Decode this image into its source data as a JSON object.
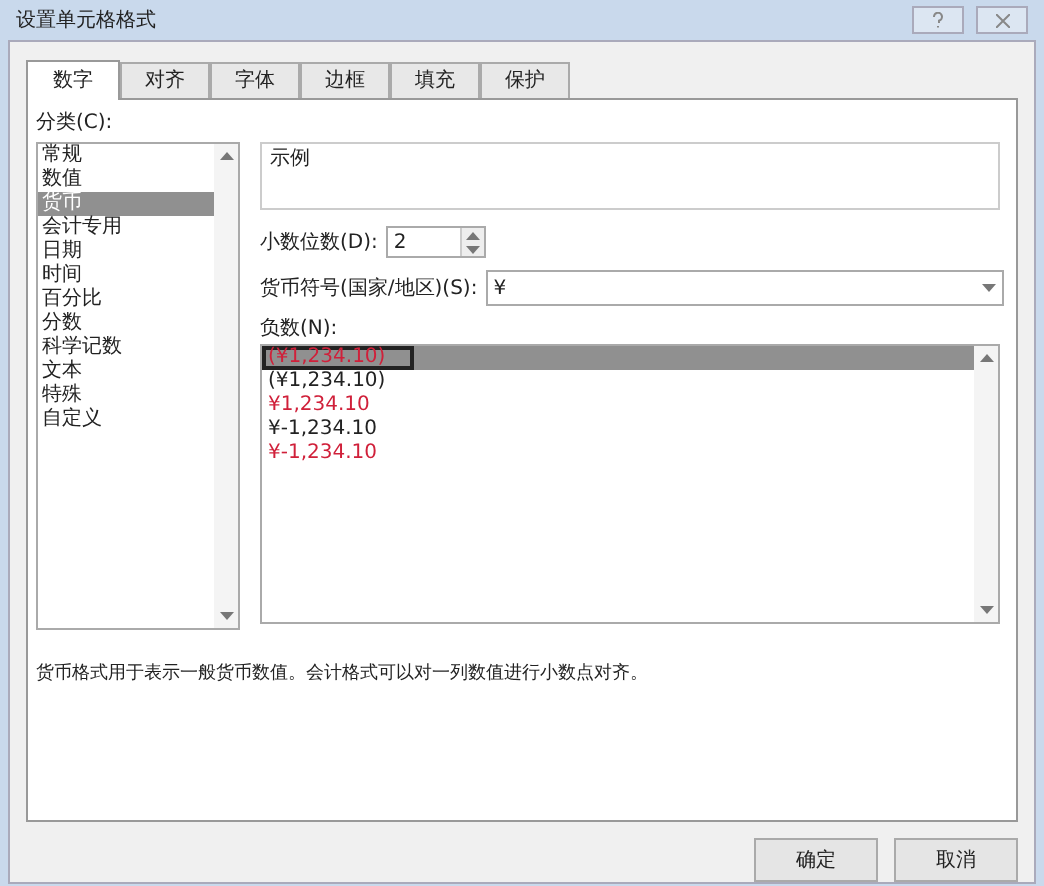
{
  "window": {
    "title": "设置单元格格式"
  },
  "tabs": [
    {
      "label": "数字",
      "selected": true
    },
    {
      "label": "对齐",
      "selected": false
    },
    {
      "label": "字体",
      "selected": false
    },
    {
      "label": "边框",
      "selected": false
    },
    {
      "label": "填充",
      "selected": false
    },
    {
      "label": "保护",
      "selected": false
    }
  ],
  "category": {
    "label": "分类(C):",
    "items": [
      {
        "label": "常规",
        "selected": false
      },
      {
        "label": "数值",
        "selected": false
      },
      {
        "label": "货币",
        "selected": true
      },
      {
        "label": "会计专用",
        "selected": false
      },
      {
        "label": "日期",
        "selected": false
      },
      {
        "label": "时间",
        "selected": false
      },
      {
        "label": "百分比",
        "selected": false
      },
      {
        "label": "分数",
        "selected": false
      },
      {
        "label": "科学记数",
        "selected": false
      },
      {
        "label": "文本",
        "selected": false
      },
      {
        "label": "特殊",
        "selected": false
      },
      {
        "label": "自定义",
        "selected": false
      }
    ]
  },
  "sample": {
    "label": "示例"
  },
  "decimal_places": {
    "label": "小数位数(D):",
    "value": "2"
  },
  "currency_symbol": {
    "label": "货币符号(国家/地区)(S):",
    "value": "¥"
  },
  "negative_numbers": {
    "label": "负数(N):",
    "items": [
      {
        "text": "(¥1,234.10)",
        "color": "#d0203a",
        "selected": true
      },
      {
        "text": "(¥1,234.10)",
        "color": "#222222",
        "selected": false
      },
      {
        "text": "¥1,234.10",
        "color": "#d0203a",
        "selected": false
      },
      {
        "text": "¥-1,234.10",
        "color": "#222222",
        "selected": false
      },
      {
        "text": "¥-1,234.10",
        "color": "#d0203a",
        "selected": false
      }
    ]
  },
  "description": "货币格式用于表示一般货币数值。会计格式可以对一列数值进行小数点对齐。",
  "buttons": [
    "确定",
    "取消"
  ]
}
